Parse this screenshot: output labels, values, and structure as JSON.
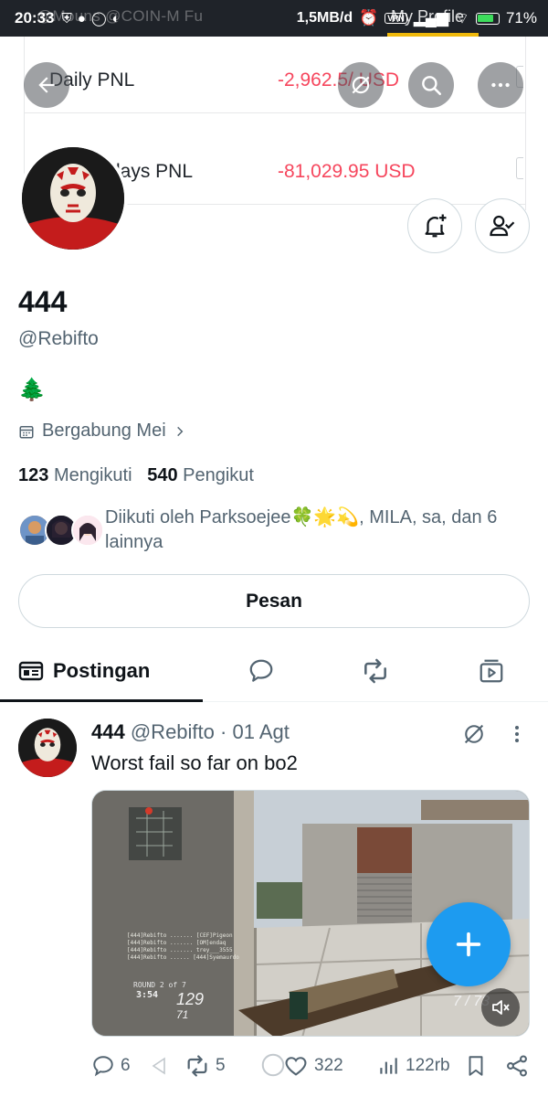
{
  "status_bar": {
    "time": "20:33",
    "ghost_text": "@Mouns  @COIN-M Fu",
    "speed": "1,5MB/d",
    "vpn": "VPN",
    "overlay_title": "My Profile",
    "battery": "71%"
  },
  "banner": {
    "rows": [
      {
        "label": "Daily PNL",
        "value": "-2,962.5/ USD"
      },
      {
        "label": "lays PNL",
        "value": "-81,029.95 USD"
      }
    ]
  },
  "profile": {
    "name": "444",
    "handle": "@Rebifto",
    "bio": "🌲",
    "joined": "Bergabung Mei",
    "following_count": "123",
    "following_label": "Mengikuti",
    "followers_count": "540",
    "followers_label": "Pengikut",
    "followed_by": "Diikuti oleh Parksoejee🍀🌟💫, MILA, sa, dan 6 lainnya",
    "message_button": "Pesan"
  },
  "tabs": {
    "active": "Postingan"
  },
  "post": {
    "name": "444",
    "handle": "@Rebifto",
    "separator": "·",
    "date": "01 Agt",
    "text": "Worst fail so far on bo2",
    "replies": "6",
    "reposts": "5",
    "likes": "322",
    "views": "122rb",
    "media_hud": {
      "round": "ROUND 2 of 7",
      "score": "3:54",
      "ammo_left": "129",
      "ammo_sub": "71",
      "ammo_right": "7 / 73"
    }
  },
  "colors": {
    "accent": "#1d9bf0",
    "negative": "#f6465d",
    "text_primary": "#0f1419",
    "text_secondary": "#536471",
    "status_bar_bg": "#1f2329",
    "binance_yellow": "#f0b90b"
  }
}
